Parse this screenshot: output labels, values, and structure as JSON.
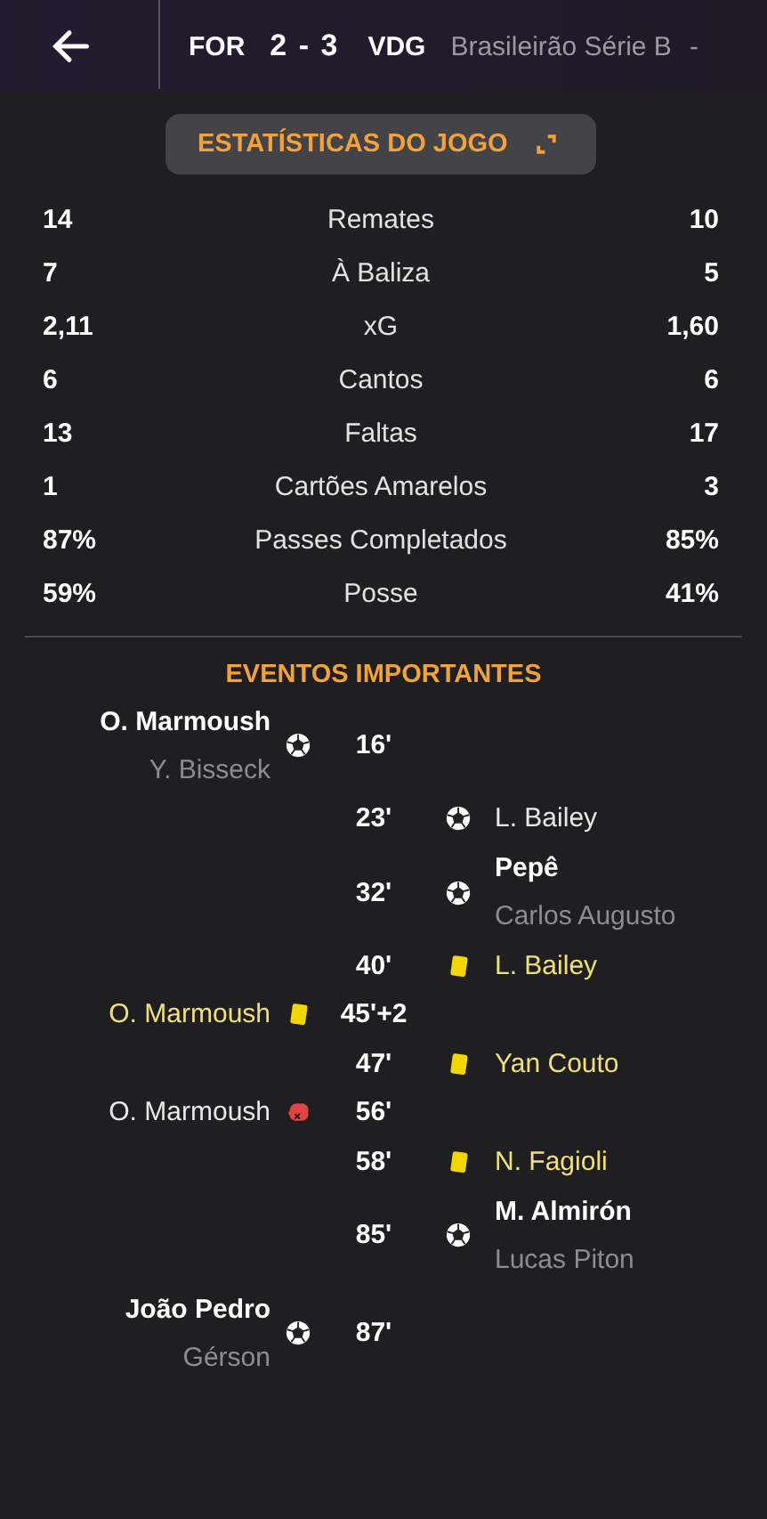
{
  "header": {
    "home": "FOR",
    "score": "2 - 3",
    "away": "VDG",
    "competition": "Brasileirão Série B",
    "separator": "-"
  },
  "stats_button": {
    "label": "ESTATÍSTICAS DO JOGO"
  },
  "stats": [
    {
      "home": "14",
      "label": "Remates",
      "away": "10"
    },
    {
      "home": "7",
      "label": "À Baliza",
      "away": "5"
    },
    {
      "home": "2,11",
      "label": "xG",
      "away": "1,60"
    },
    {
      "home": "6",
      "label": "Cantos",
      "away": "6"
    },
    {
      "home": "13",
      "label": "Faltas",
      "away": "17"
    },
    {
      "home": "1",
      "label": "Cartões Amarelos",
      "away": "3"
    },
    {
      "home": "87%",
      "label": "Passes Completados",
      "away": "85%"
    },
    {
      "home": "59%",
      "label": "Posse",
      "away": "41%"
    }
  ],
  "events_title": "EVENTOS IMPORTANTES",
  "events": [
    {
      "home_team": true,
      "kind": "goal",
      "minute": "16'",
      "player": "O. Marmoush",
      "assist": "Y. Bisseck"
    },
    {
      "home_team": false,
      "kind": "goal",
      "minute": "23'",
      "player": "L. Bailey"
    },
    {
      "home_team": false,
      "kind": "goal",
      "minute": "32'",
      "player": "Pepê",
      "assist": "Carlos Augusto"
    },
    {
      "home_team": false,
      "kind": "booking",
      "minute": "40'",
      "player": "L. Bailey"
    },
    {
      "home_team": true,
      "kind": "booking",
      "minute": "45'+2",
      "player": "O. Marmoush"
    },
    {
      "home_team": false,
      "kind": "booking",
      "minute": "47'",
      "player": "Yan Couto"
    },
    {
      "home_team": true,
      "kind": "injury",
      "minute": "56'",
      "player": "O. Marmoush"
    },
    {
      "home_team": false,
      "kind": "booking",
      "minute": "58'",
      "player": "N. Fagioli"
    },
    {
      "home_team": false,
      "kind": "goal",
      "minute": "85'",
      "player": "M. Almirón",
      "assist": "Lucas Piton"
    },
    {
      "home_team": true,
      "kind": "goal",
      "minute": "87'",
      "player": "João Pedro",
      "assist": "Gérson"
    }
  ]
}
